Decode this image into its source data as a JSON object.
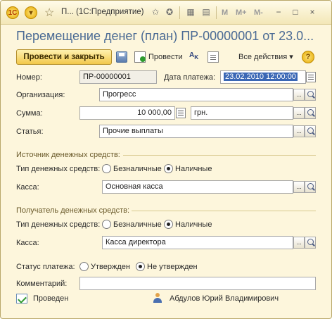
{
  "titlebar": {
    "tab_short": "П...",
    "tab_title": "(1С:Предприятие)",
    "m_label": "M",
    "mplus_label": "M+",
    "mminus_label": "M-",
    "minimize": "−",
    "maximize": "□",
    "close": "×"
  },
  "heading": "Перемещение денег (план) ПР-00000001 от 23.0...",
  "toolbar": {
    "post_and_close": "Провести и закрыть",
    "post": "Провести",
    "all_actions": "Все действия ▾",
    "help": "?"
  },
  "form": {
    "number_label": "Номер:",
    "number_value": "ПР-00000001",
    "date_label": "Дата платежа:",
    "date_value": "23.02.2010 12:00:00",
    "org_label": "Организация:",
    "org_value": "Прогресс",
    "sum_label": "Сумма:",
    "sum_value": "10 000,00",
    "currency_value": "грн.",
    "article_label": "Статья:",
    "article_value": "Прочие выплаты",
    "source_group": "Источник денежных средств:",
    "source_type_label": "Тип денежных средств:",
    "cashless": "Безналичные",
    "cash": "Наличные",
    "source_kassa_label": "Касса:",
    "source_kassa_value": "Основная касса",
    "receiver_group": "Получатель денежных средств:",
    "receiver_type_label": "Тип денежных средств:",
    "receiver_kassa_label": "Касса:",
    "receiver_kassa_value": "Касса директора",
    "status_label": "Статус платежа:",
    "approved": "Утвержден",
    "not_approved": "Не утвержден",
    "comment_label": "Комментарий:",
    "comment_value": ""
  },
  "footer": {
    "posted": "Проведен",
    "user": "Абдулов Юрий Владимирович"
  },
  "selections": {
    "source_type": "Наличные",
    "receiver_type": "Наличные",
    "status": "Не утвержден"
  },
  "colors": {
    "window_bg": "#fdf6dc",
    "heading": "#4a6a94",
    "primary_button": "#f2c84a",
    "date_selection": "#3a67b5"
  }
}
